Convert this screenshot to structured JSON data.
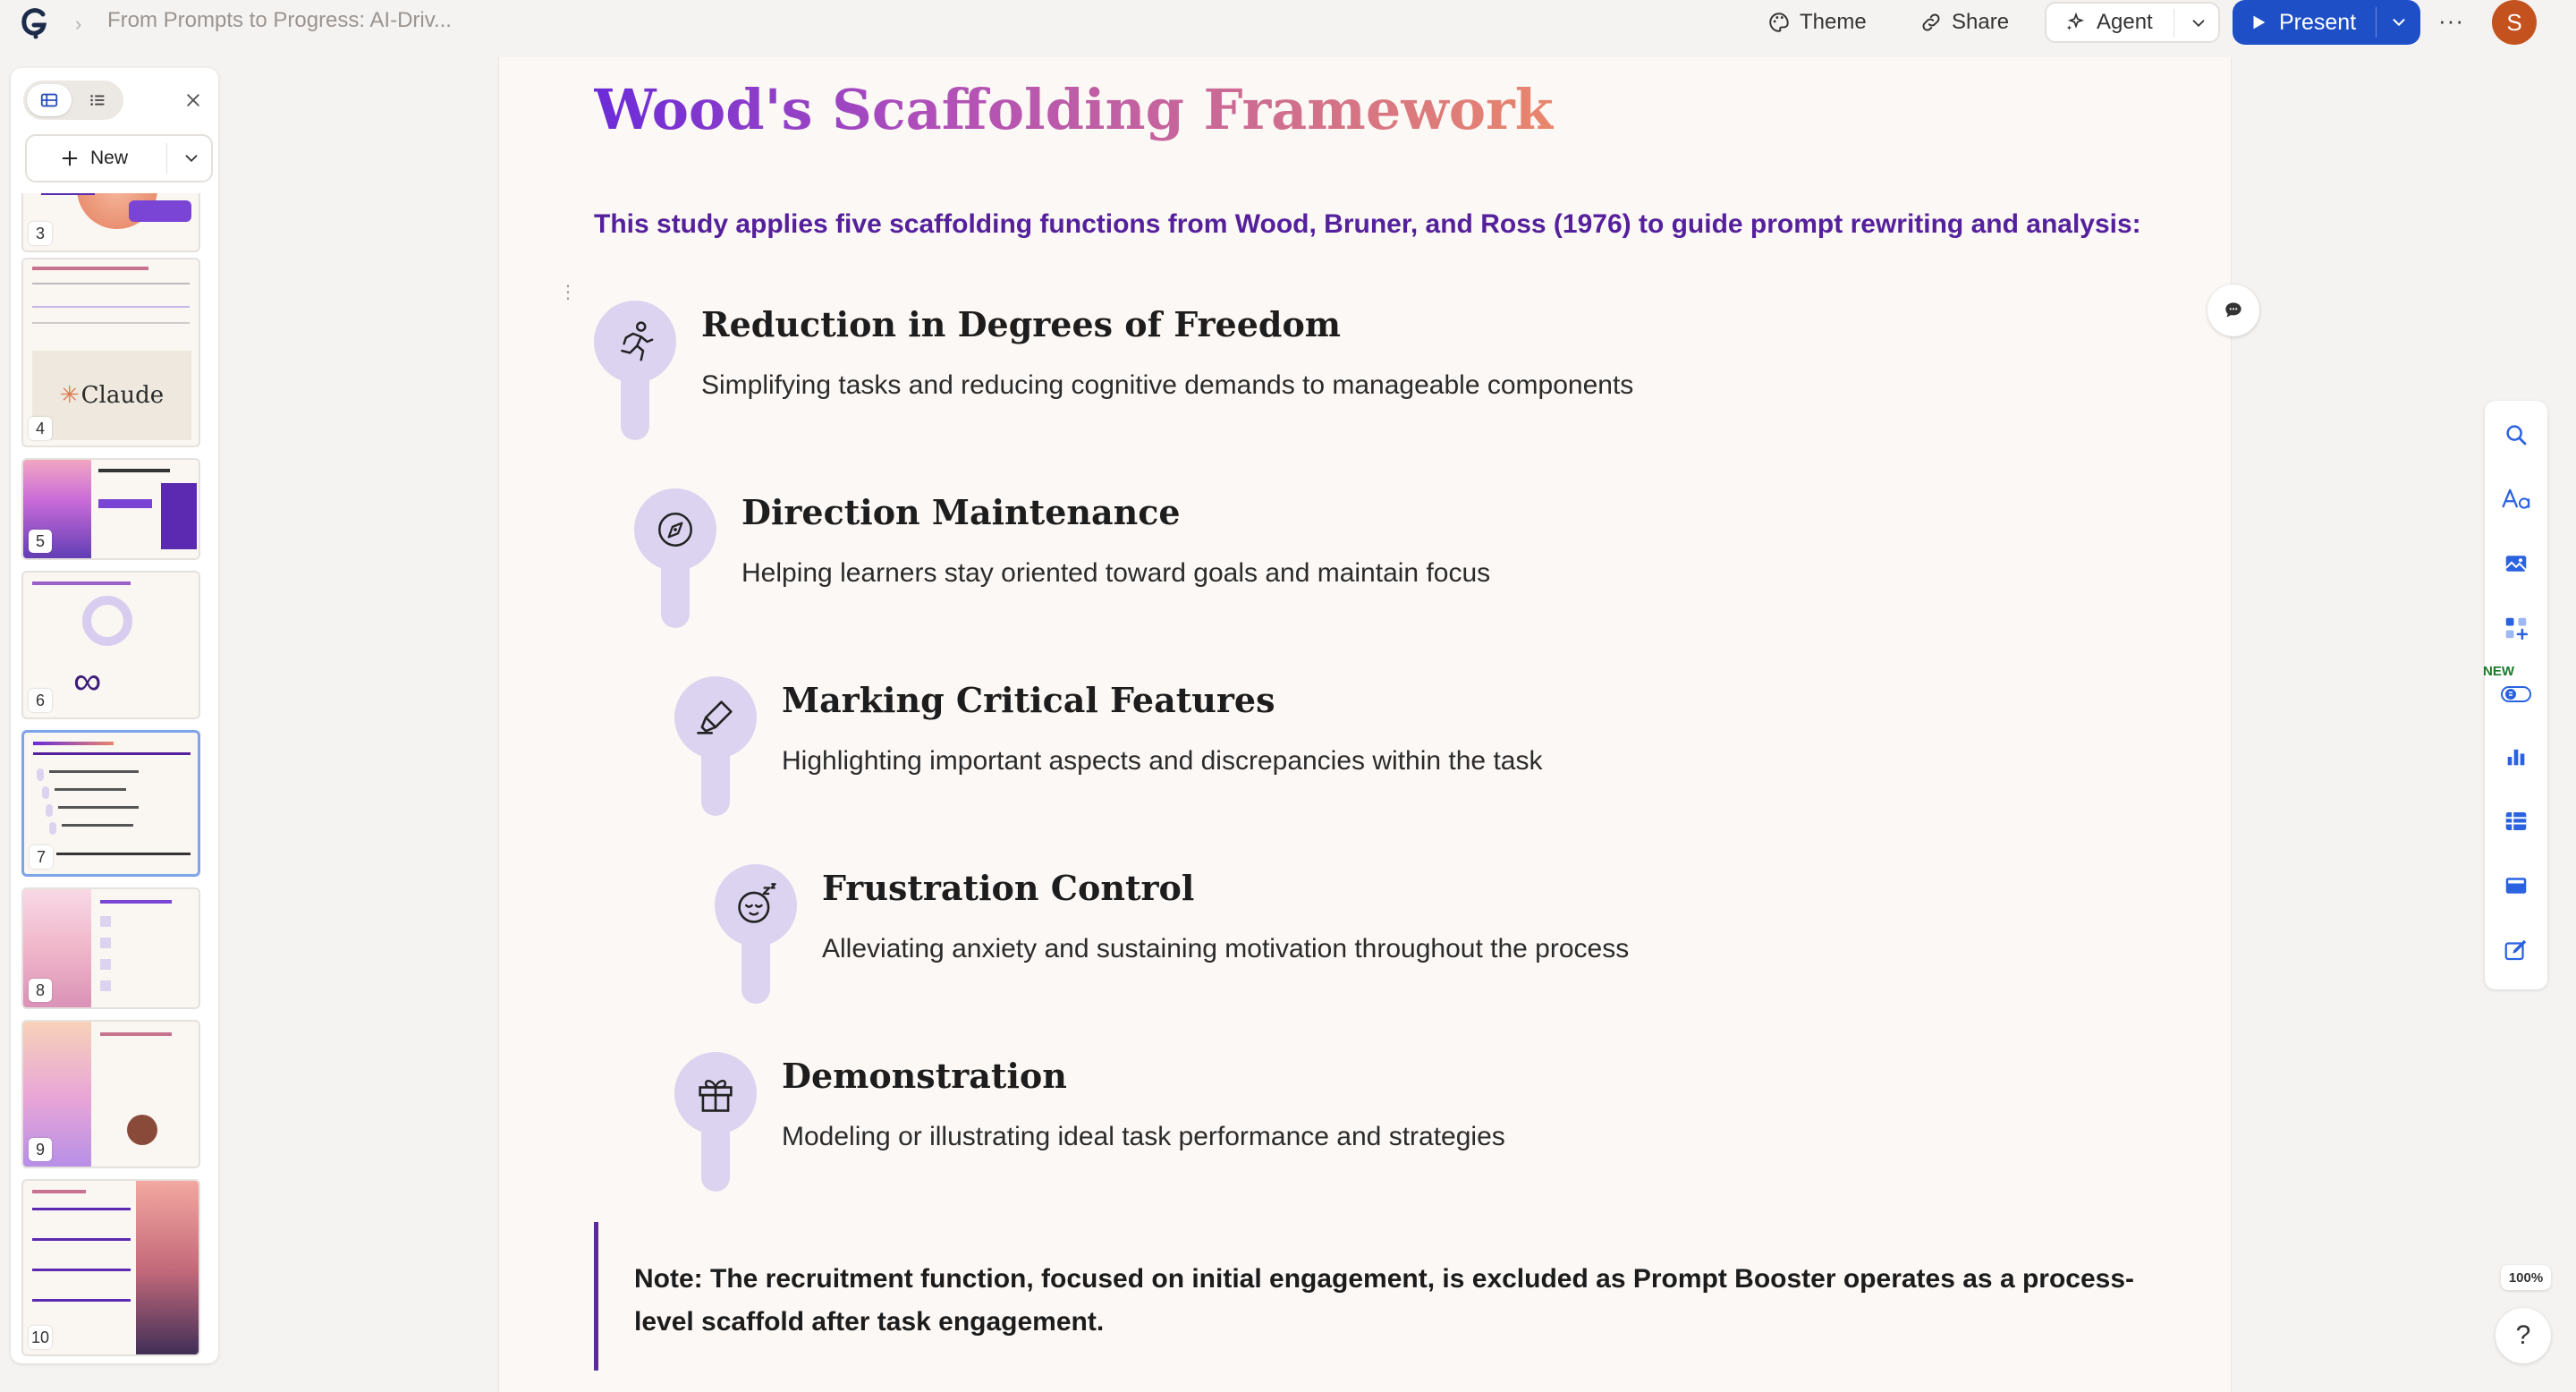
{
  "topbar": {
    "doc_title": "From Prompts to Progress: AI-Driv...",
    "theme_label": "Theme",
    "share_label": "Share",
    "agent_label": "Agent",
    "present_label": "Present",
    "avatar_initial": "S",
    "more_label": "···"
  },
  "panel": {
    "new_label": "New",
    "thumbnails": [
      {
        "num": "3"
      },
      {
        "num": "4"
      },
      {
        "num": "5"
      },
      {
        "num": "6"
      },
      {
        "num": "7"
      },
      {
        "num": "8"
      },
      {
        "num": "9"
      },
      {
        "num": "10"
      }
    ],
    "thumb4_word": "Claude"
  },
  "slide": {
    "title": "Wood's Scaffolding Framework",
    "subtitle": "This study applies five scaffolding functions from Wood, Bruner, and Ross (1976) to guide prompt rewriting and analysis:",
    "items": [
      {
        "title": "Reduction in Degrees of Freedom",
        "desc": "Simplifying tasks and reducing cognitive demands to manageable components",
        "icon": "runner-icon"
      },
      {
        "title": "Direction Maintenance",
        "desc": "Helping learners stay oriented toward goals and maintain focus",
        "icon": "compass-icon"
      },
      {
        "title": "Marking Critical Features",
        "desc": "Highlighting important aspects and discrepancies within the task",
        "icon": "highlighter-icon"
      },
      {
        "title": "Frustration Control",
        "desc": "Alleviating anxiety and sustaining motivation throughout the process",
        "icon": "sleepy-face-icon"
      },
      {
        "title": "Demonstration",
        "desc": "Modeling or illustrating ideal task performance and strategies",
        "icon": "gift-icon"
      }
    ],
    "note": "Note: The recruitment function, focused on initial engagement, is excluded as Prompt Booster operates as a process-level scaffold after task engagement."
  },
  "righttools": {
    "new_badge": "NEW",
    "zoom": "100%",
    "help": "?"
  },
  "colors": {
    "accent_blue": "#1f4fc7",
    "title_purple": "#6a2bd9",
    "title_orange": "#e8866c",
    "subtitle_purple": "#55209c",
    "icon_bg": "#dcd3f0",
    "avatar": "#c4521e"
  }
}
